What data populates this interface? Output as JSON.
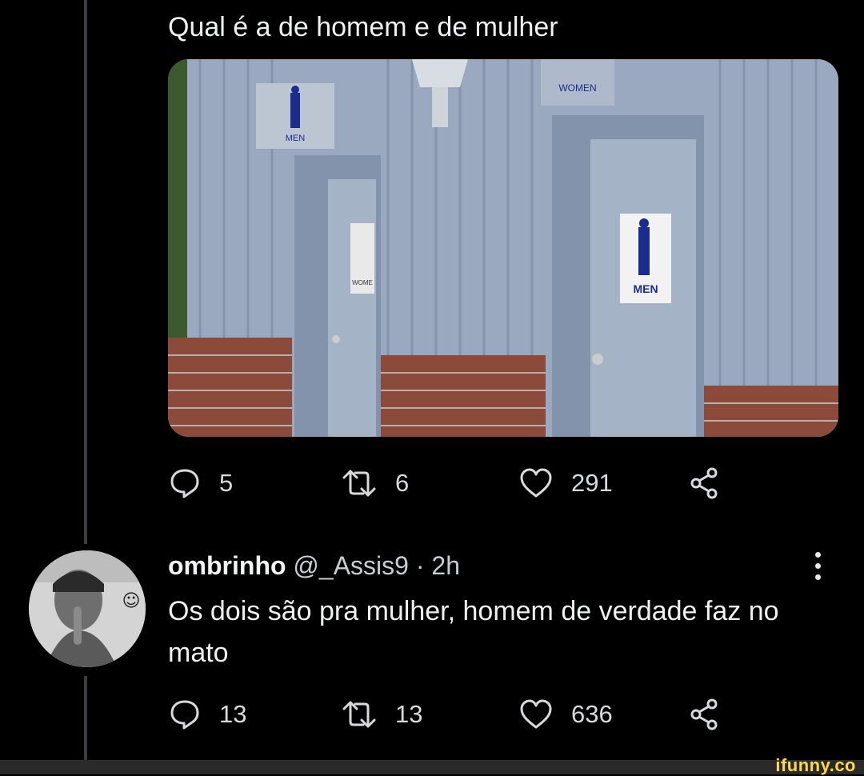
{
  "tweet1": {
    "text": "Qual é a de homem e de mulher",
    "media": {
      "sign_top_left": "MEN",
      "sign_top_center": "WOMEN",
      "door_left_sign": "WOME",
      "door_right_sign": "MEN"
    },
    "actions": {
      "replies": "5",
      "retweets": "6",
      "likes": "291"
    }
  },
  "tweet2": {
    "name": "ombrinho",
    "handle": "@_Assis9",
    "time": "· 2h",
    "text": "Os dois são pra mulher, homem de verdade faz no mato",
    "actions": {
      "replies": "13",
      "retweets": "13",
      "likes": "636"
    }
  },
  "watermark": "ifunny.co",
  "icons": {
    "reply": "reply-icon",
    "retweet": "retweet-icon",
    "like": "like-icon",
    "share": "share-icon",
    "more": "more-icon"
  },
  "colors": {
    "background": "#000000",
    "text": "#e7e9ea",
    "icon": "#d7d9dc",
    "watermark": "#ffd84a"
  }
}
